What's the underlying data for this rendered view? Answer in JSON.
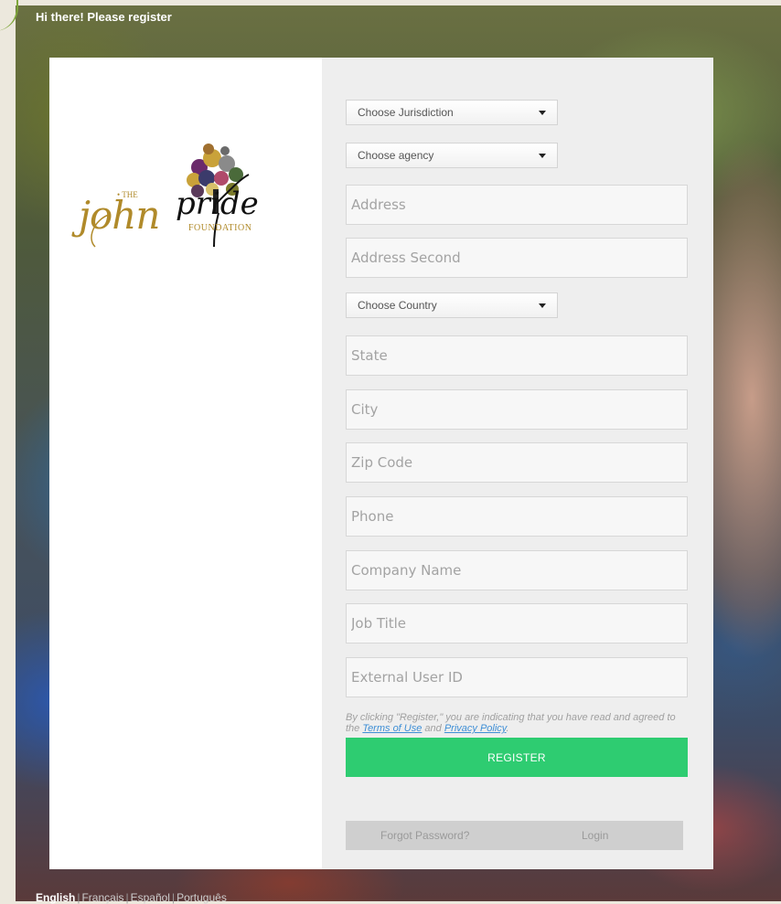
{
  "header": {
    "text": "Hi there! Please register"
  },
  "logo": {
    "the": "• THE",
    "john": "john",
    "pride": "pride",
    "foundation": "FOUNDATION"
  },
  "form": {
    "jurisdiction_select": "Choose Jurisdiction",
    "agency_select": "Choose agency",
    "address_placeholder": "Address",
    "address_second_placeholder": "Address Second",
    "country_select": "Choose Country",
    "state_placeholder": "State",
    "city_placeholder": "City",
    "zip_placeholder": "Zip Code",
    "phone_placeholder": "Phone",
    "company_placeholder": "Company Name",
    "job_title_placeholder": "Job Title",
    "external_id_placeholder": "External User ID"
  },
  "terms": {
    "prefix": "By clicking \"Register,\" you are indicating that you have read and agreed to the ",
    "terms_link": "Terms of Use",
    "and": " and ",
    "privacy_link": "Privacy Policy",
    "suffix": "."
  },
  "buttons": {
    "register": "REGISTER",
    "forgot": "Forgot Password?",
    "login": "Login"
  },
  "languages": [
    "English",
    "Français",
    "Español",
    "Português"
  ],
  "colors": {
    "accent": "#2ecc71",
    "logo_gold": "#b08a2a"
  }
}
